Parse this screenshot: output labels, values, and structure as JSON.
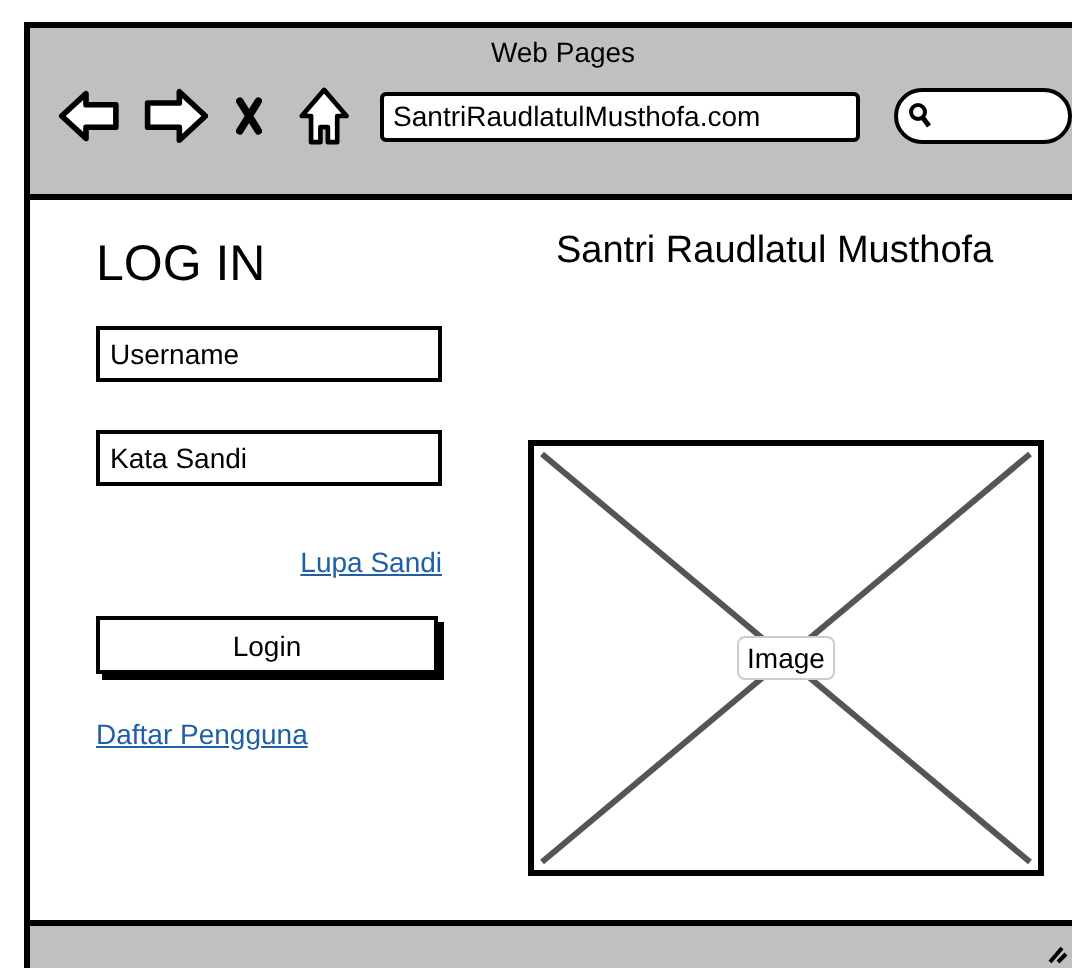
{
  "window": {
    "title": "Web Pages"
  },
  "toolbar": {
    "url": "SantriRaudlatulMusthofa.com"
  },
  "login": {
    "heading": "LOG IN",
    "fields": [
      {
        "value": "Username"
      },
      {
        "value": "Kata Sandi"
      }
    ],
    "forgot_link": "Lupa Sandi",
    "button": "Login",
    "register_link": "Daftar Pengguna"
  },
  "site_title": "Santri Raudlatul Musthofa",
  "image": {
    "label": "Image"
  }
}
